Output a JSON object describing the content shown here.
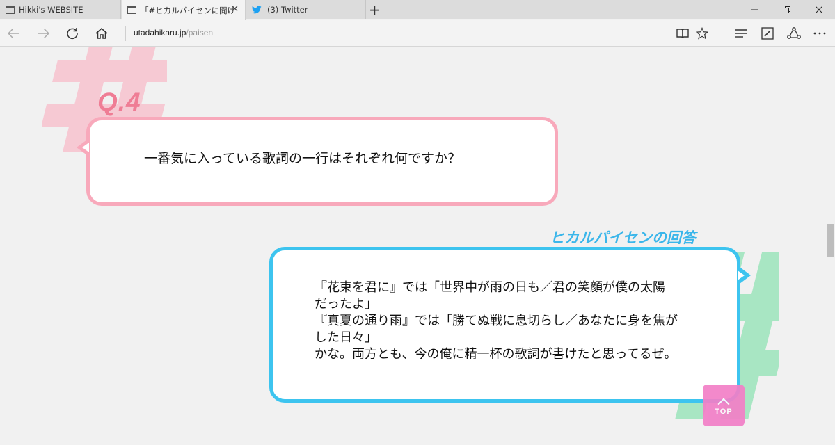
{
  "browser": {
    "tabs": [
      {
        "label": "Hikki's WEBSITE",
        "active": false
      },
      {
        "label": "「#ヒカルパイセンに聞け」Q&",
        "active": true
      },
      {
        "label": "(3) Twitter",
        "active": false
      }
    ],
    "close_glyph": "✕",
    "new_tab_glyph": "+",
    "url_host": "utadahikaru.jp",
    "url_path": "/paisen"
  },
  "question": {
    "label": "Q.4",
    "text": "一番気に入っている歌詞の一行はそれぞれ何ですか？"
  },
  "answer": {
    "label": "ヒカルパイセンの回答",
    "lines": [
      "『花束を君に』では「世界中が雨の日も／君の笑顔が僕の太陽",
      "だったよ」",
      "『真夏の通り雨』では「勝てぬ戦に息切らし／あなたに身を焦が",
      "した日々」",
      "かな。両方とも、今の俺に精一杯の歌詞が書けたと思ってるぜ。"
    ]
  },
  "top_button": {
    "label": "TOP"
  },
  "decor": {
    "hash_glyph": "#"
  },
  "colors": {
    "question_accent": "#f8a9bb",
    "question_label": "#ef7d95",
    "answer_accent": "#3dc4ef",
    "answer_label": "#3bb6ea",
    "top_button": "#f27fc7",
    "hash_pink": "#f6c9d3",
    "hash_green": "#a8e6c3"
  }
}
